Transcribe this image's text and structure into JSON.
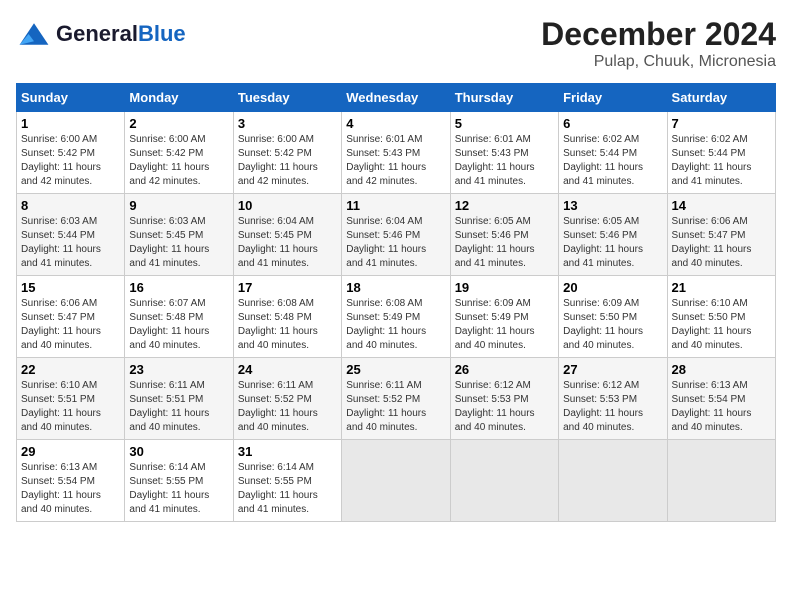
{
  "header": {
    "logo_general": "General",
    "logo_blue": "Blue",
    "month_year": "December 2024",
    "location": "Pulap, Chuuk, Micronesia"
  },
  "days_of_week": [
    "Sunday",
    "Monday",
    "Tuesday",
    "Wednesday",
    "Thursday",
    "Friday",
    "Saturday"
  ],
  "weeks": [
    [
      {
        "day": "1",
        "info": "Sunrise: 6:00 AM\nSunset: 5:42 PM\nDaylight: 11 hours\nand 42 minutes."
      },
      {
        "day": "2",
        "info": "Sunrise: 6:00 AM\nSunset: 5:42 PM\nDaylight: 11 hours\nand 42 minutes."
      },
      {
        "day": "3",
        "info": "Sunrise: 6:00 AM\nSunset: 5:42 PM\nDaylight: 11 hours\nand 42 minutes."
      },
      {
        "day": "4",
        "info": "Sunrise: 6:01 AM\nSunset: 5:43 PM\nDaylight: 11 hours\nand 42 minutes."
      },
      {
        "day": "5",
        "info": "Sunrise: 6:01 AM\nSunset: 5:43 PM\nDaylight: 11 hours\nand 41 minutes."
      },
      {
        "day": "6",
        "info": "Sunrise: 6:02 AM\nSunset: 5:44 PM\nDaylight: 11 hours\nand 41 minutes."
      },
      {
        "day": "7",
        "info": "Sunrise: 6:02 AM\nSunset: 5:44 PM\nDaylight: 11 hours\nand 41 minutes."
      }
    ],
    [
      {
        "day": "8",
        "info": "Sunrise: 6:03 AM\nSunset: 5:44 PM\nDaylight: 11 hours\nand 41 minutes."
      },
      {
        "day": "9",
        "info": "Sunrise: 6:03 AM\nSunset: 5:45 PM\nDaylight: 11 hours\nand 41 minutes."
      },
      {
        "day": "10",
        "info": "Sunrise: 6:04 AM\nSunset: 5:45 PM\nDaylight: 11 hours\nand 41 minutes."
      },
      {
        "day": "11",
        "info": "Sunrise: 6:04 AM\nSunset: 5:46 PM\nDaylight: 11 hours\nand 41 minutes."
      },
      {
        "day": "12",
        "info": "Sunrise: 6:05 AM\nSunset: 5:46 PM\nDaylight: 11 hours\nand 41 minutes."
      },
      {
        "day": "13",
        "info": "Sunrise: 6:05 AM\nSunset: 5:46 PM\nDaylight: 11 hours\nand 41 minutes."
      },
      {
        "day": "14",
        "info": "Sunrise: 6:06 AM\nSunset: 5:47 PM\nDaylight: 11 hours\nand 40 minutes."
      }
    ],
    [
      {
        "day": "15",
        "info": "Sunrise: 6:06 AM\nSunset: 5:47 PM\nDaylight: 11 hours\nand 40 minutes."
      },
      {
        "day": "16",
        "info": "Sunrise: 6:07 AM\nSunset: 5:48 PM\nDaylight: 11 hours\nand 40 minutes."
      },
      {
        "day": "17",
        "info": "Sunrise: 6:08 AM\nSunset: 5:48 PM\nDaylight: 11 hours\nand 40 minutes."
      },
      {
        "day": "18",
        "info": "Sunrise: 6:08 AM\nSunset: 5:49 PM\nDaylight: 11 hours\nand 40 minutes."
      },
      {
        "day": "19",
        "info": "Sunrise: 6:09 AM\nSunset: 5:49 PM\nDaylight: 11 hours\nand 40 minutes."
      },
      {
        "day": "20",
        "info": "Sunrise: 6:09 AM\nSunset: 5:50 PM\nDaylight: 11 hours\nand 40 minutes."
      },
      {
        "day": "21",
        "info": "Sunrise: 6:10 AM\nSunset: 5:50 PM\nDaylight: 11 hours\nand 40 minutes."
      }
    ],
    [
      {
        "day": "22",
        "info": "Sunrise: 6:10 AM\nSunset: 5:51 PM\nDaylight: 11 hours\nand 40 minutes."
      },
      {
        "day": "23",
        "info": "Sunrise: 6:11 AM\nSunset: 5:51 PM\nDaylight: 11 hours\nand 40 minutes."
      },
      {
        "day": "24",
        "info": "Sunrise: 6:11 AM\nSunset: 5:52 PM\nDaylight: 11 hours\nand 40 minutes."
      },
      {
        "day": "25",
        "info": "Sunrise: 6:11 AM\nSunset: 5:52 PM\nDaylight: 11 hours\nand 40 minutes."
      },
      {
        "day": "26",
        "info": "Sunrise: 6:12 AM\nSunset: 5:53 PM\nDaylight: 11 hours\nand 40 minutes."
      },
      {
        "day": "27",
        "info": "Sunrise: 6:12 AM\nSunset: 5:53 PM\nDaylight: 11 hours\nand 40 minutes."
      },
      {
        "day": "28",
        "info": "Sunrise: 6:13 AM\nSunset: 5:54 PM\nDaylight: 11 hours\nand 40 minutes."
      }
    ],
    [
      {
        "day": "29",
        "info": "Sunrise: 6:13 AM\nSunset: 5:54 PM\nDaylight: 11 hours\nand 40 minutes."
      },
      {
        "day": "30",
        "info": "Sunrise: 6:14 AM\nSunset: 5:55 PM\nDaylight: 11 hours\nand 41 minutes."
      },
      {
        "day": "31",
        "info": "Sunrise: 6:14 AM\nSunset: 5:55 PM\nDaylight: 11 hours\nand 41 minutes."
      },
      {
        "day": "",
        "info": ""
      },
      {
        "day": "",
        "info": ""
      },
      {
        "day": "",
        "info": ""
      },
      {
        "day": "",
        "info": ""
      }
    ]
  ]
}
